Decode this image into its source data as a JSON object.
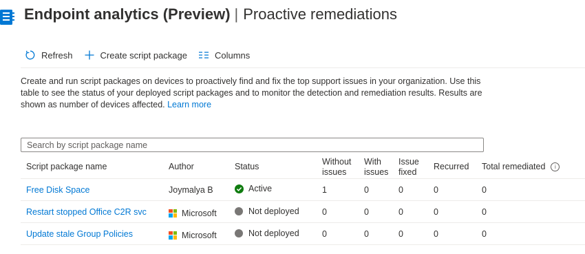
{
  "header": {
    "title_main": "Endpoint analytics (Preview)",
    "title_separator": "|",
    "title_sub": "Proactive remediations"
  },
  "toolbar": {
    "refresh_label": "Refresh",
    "create_label": "Create script package",
    "columns_label": "Columns"
  },
  "description": {
    "text": "Create and run script packages on devices to proactively find and fix the top support issues in your organization. Use this table to see the status of your deployed script packages and to monitor the detection and remediation results. Results are shown as number of devices affected.",
    "link_text": "Learn more"
  },
  "search": {
    "placeholder": "Search by script package name"
  },
  "table": {
    "columns": [
      "Script package name",
      "Author",
      "Status",
      "Without issues",
      "With issues",
      "Issue fixed",
      "Recurred",
      "Total remediated"
    ],
    "rows": [
      {
        "name": "Free Disk Space",
        "author": "Joymalya B",
        "author_icon": "none",
        "status": "Active",
        "status_icon": "check-circle-icon",
        "without": "1",
        "with": "0",
        "fixed": "0",
        "recurred": "0",
        "total": "0"
      },
      {
        "name": "Restart stopped Office C2R svc",
        "author": "Microsoft",
        "author_icon": "microsoft-logo-icon",
        "status": "Not deployed",
        "status_icon": "gray-dot-icon",
        "without": "0",
        "with": "0",
        "fixed": "0",
        "recurred": "0",
        "total": "0"
      },
      {
        "name": "Update stale Group Policies",
        "author": "Microsoft",
        "author_icon": "microsoft-logo-icon",
        "status": "Not deployed",
        "status_icon": "gray-dot-icon",
        "without": "0",
        "with": "0",
        "fixed": "0",
        "recurred": "0",
        "total": "0"
      }
    ]
  },
  "colors": {
    "accent": "#0078d4",
    "active_green": "#107c10",
    "not_deployed_gray": "#797775",
    "ms_red": "#f25022",
    "ms_green": "#7fba00",
    "ms_blue": "#00a4ef",
    "ms_yellow": "#ffb900"
  }
}
